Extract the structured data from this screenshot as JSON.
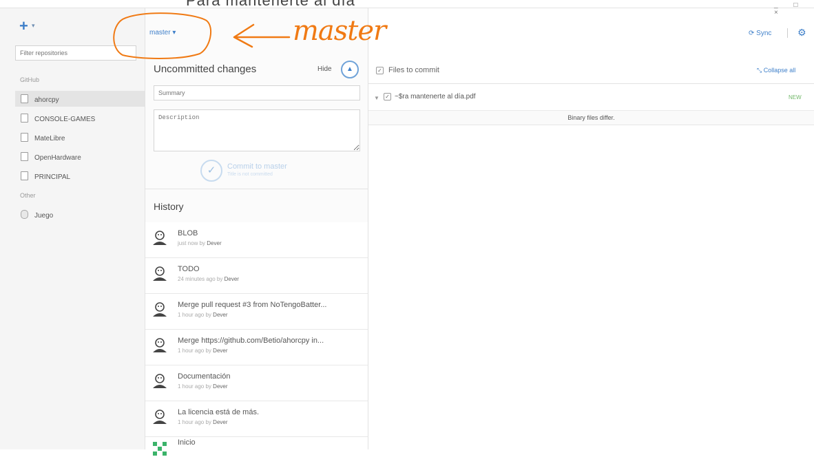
{
  "header_partial_title": "Para mantenerte al día",
  "window_controls": "_ □ ×",
  "toolbar": {
    "add_icon": "plus-icon",
    "add_caret": "▾",
    "branch_label": "master",
    "branch_caret": "▾",
    "sync_label": "Sync",
    "settings_icon": "gear-icon"
  },
  "sidebar": {
    "filter_placeholder": "Filter repositories",
    "groups": [
      {
        "label": "GitHub",
        "items": [
          {
            "label": "ahorcpy",
            "active": true
          },
          {
            "label": "CONSOLE-GAMES"
          },
          {
            "label": "MateLibre"
          },
          {
            "label": "OpenHardware"
          },
          {
            "label": "PRINCIPAL"
          }
        ]
      },
      {
        "label": "Other",
        "items": [
          {
            "label": "Juego"
          }
        ]
      }
    ]
  },
  "changes": {
    "title": "Uncommitted changes",
    "hide_label": "Hide",
    "summary_placeholder": "Summary",
    "description_placeholder": "Description",
    "commit_label": "Commit to master",
    "commit_sublabel": "Title is not committed"
  },
  "history": {
    "title": "History",
    "items": [
      {
        "title": "BLOB",
        "time": "just now by",
        "author": "Dever"
      },
      {
        "title": "TODO",
        "time": "24 minutes ago by",
        "author": "Dever"
      },
      {
        "title": "Merge pull request #3 from NoTengoBatter...",
        "time": "1 hour ago by",
        "author": "Dever"
      },
      {
        "title": "Merge https://github.com/Betio/ahorcpy in...",
        "time": "1 hour ago by",
        "author": "Dever"
      },
      {
        "title": "Documentación",
        "time": "1 hour ago by",
        "author": "Dever"
      },
      {
        "title": "La licencia está de más.",
        "time": "1 hour ago by",
        "author": "Dever"
      },
      {
        "title": "Inicio",
        "time": "",
        "author": ""
      }
    ]
  },
  "files": {
    "header_label": "Files to commit",
    "collapse_label": "Collapse all",
    "items": [
      {
        "name": "~$ra mantenerte al día.pdf",
        "status": "NEW",
        "diff": "Binary files differ."
      }
    ]
  },
  "annotation": {
    "handwritten_text": "master",
    "color": "#f07a14"
  },
  "colors": {
    "accent": "#3e7fc9",
    "new_status": "#72b86a",
    "annotation": "#f07a14"
  }
}
